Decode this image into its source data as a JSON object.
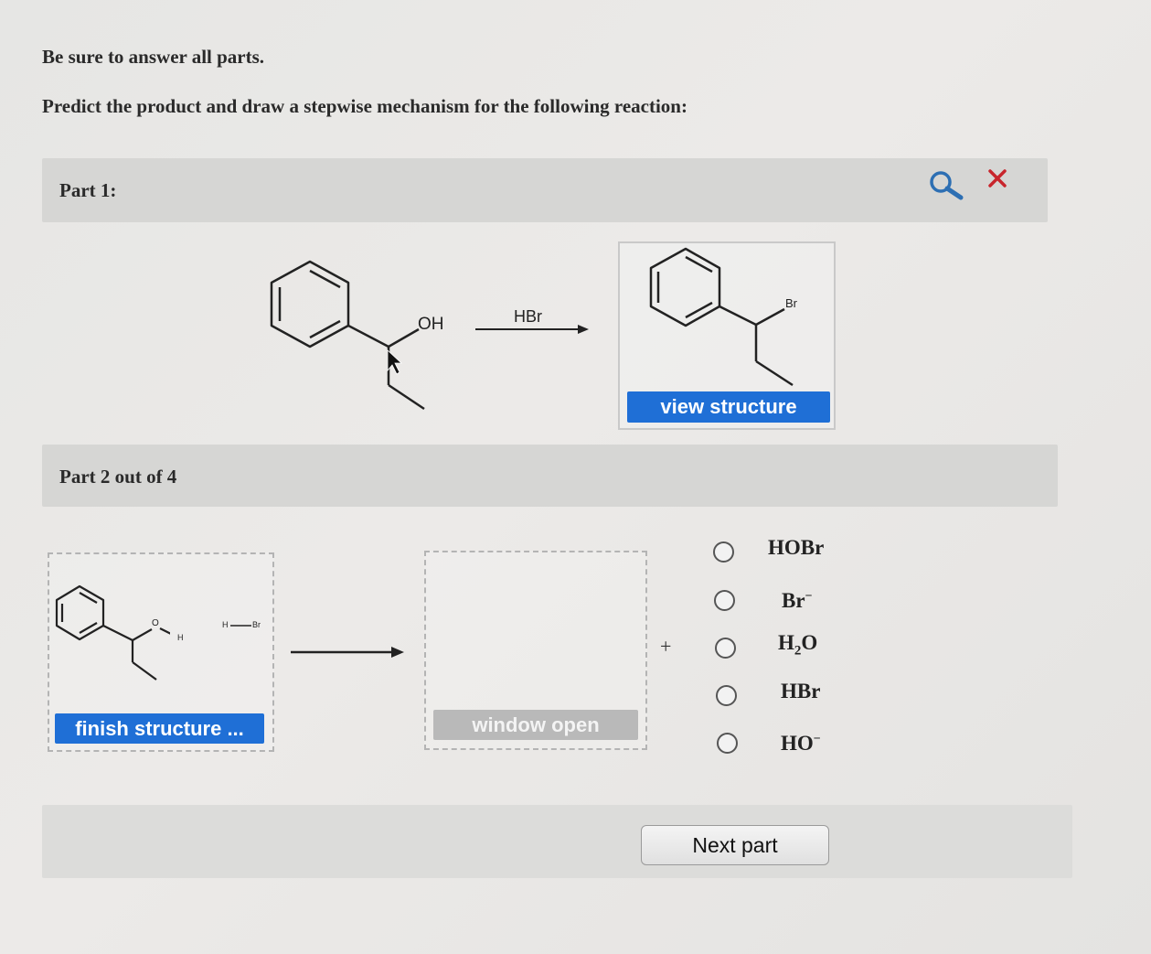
{
  "instructions": {
    "line1": "Be sure to answer all parts.",
    "line2": "Predict the product and draw a stepwise mechanism for the following reaction:"
  },
  "part1": {
    "title": "Part 1:",
    "reactant_group_label": "OH",
    "reagent": "HBr",
    "product_atom_label": "Br",
    "view_button": "view structure",
    "icons": [
      "magnifier-icon",
      "close-x-icon"
    ],
    "close_color": "#c8252c"
  },
  "part2": {
    "title": "Part 2 out of 4",
    "mol_o": "O",
    "mol_h": "H",
    "hbr_h": "H",
    "hbr_br": "Br",
    "finish_button": "finish structure ...",
    "window_button": "window open",
    "plus": "+",
    "options": [
      {
        "base": "HOBr",
        "sub": "",
        "rest": "",
        "sup": ""
      },
      {
        "base": "Br",
        "sub": "",
        "rest": "",
        "sup": "−"
      },
      {
        "base": "H",
        "sub": "2",
        "rest": "O",
        "sup": ""
      },
      {
        "base": "HBr",
        "sub": "",
        "rest": "",
        "sup": ""
      },
      {
        "base": "HO",
        "sub": "",
        "rest": "",
        "sup": "−"
      }
    ]
  },
  "footer": {
    "next_button": "Next part"
  },
  "colors": {
    "accent_blue": "#1f6fd6",
    "disabled_gray": "#b9b9b9",
    "part_bar": "#d6d6d4"
  }
}
